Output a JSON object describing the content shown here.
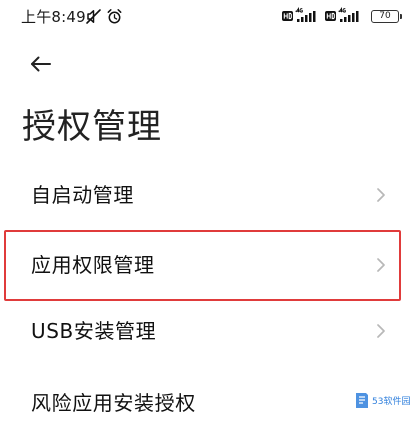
{
  "status_bar": {
    "time": "上午8:49",
    "battery": "70",
    "icons": [
      "mute-icon",
      "alarm-icon",
      "signal-icon",
      "signal-icon",
      "battery-icon"
    ]
  },
  "header": {
    "back_icon": "back-arrow-icon",
    "title": "授权管理"
  },
  "menu": {
    "items": [
      {
        "label": "自启动管理"
      },
      {
        "label": "应用权限管理"
      },
      {
        "label": "USB安装管理"
      },
      {
        "label": "风险应用安装授权"
      }
    ]
  },
  "highlight": {
    "color": "#e03b3b"
  },
  "watermark": {
    "text": "53软件园"
  }
}
